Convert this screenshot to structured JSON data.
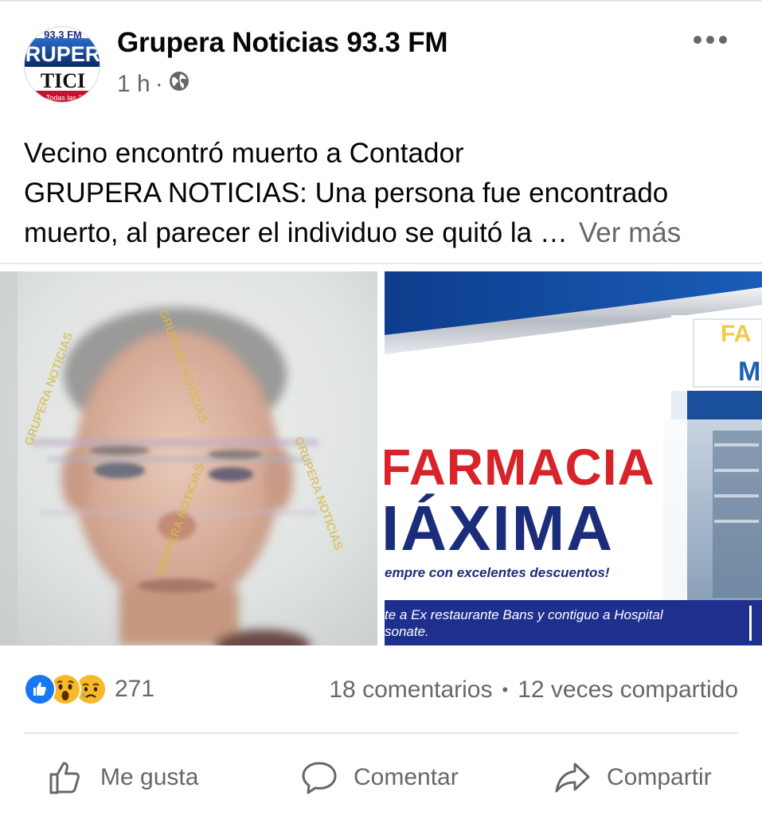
{
  "post": {
    "page_name": "Grupera Noticias 93.3 FM",
    "time": "1 h",
    "separator": "·",
    "audience_icon": "globe-icon",
    "more_icon": "more-horizontal-icon",
    "text_lines": [
      "Vecino  encontró muerto a Contador",
      "GRUPERA NOTICIAS: Una persona fue encontrado",
      "muerto, al parecer el individuo se quitó la …"
    ],
    "see_more": "Ver más"
  },
  "avatar": {
    "top": "93.3 FM",
    "middle": "RUPER",
    "bottom": "TICI",
    "tagline": "Todas las 24"
  },
  "photo_left": {
    "watermark": "GRUPERA NOTICIAS"
  },
  "photo_right": {
    "headline_1": "FARMACIA",
    "headline_2": "IÁXIMA",
    "slogan": "empre con excelentes descuentos!",
    "address_1": "te a Ex restaurante Bans y contiguo a Hospital",
    "address_2": "sonate.",
    "sign_partial_1": "FA",
    "sign_partial_2": "M"
  },
  "engagement": {
    "reactions": [
      "like-icon",
      "wow-icon",
      "sad-icon"
    ],
    "reaction_count": "271",
    "comments": "18 comentarios",
    "dot": "•",
    "shares": "12 veces compartido"
  },
  "actions": {
    "like": "Me gusta",
    "comment": "Comentar",
    "share": "Compartir"
  },
  "colors": {
    "text_primary": "#050505",
    "text_secondary": "#65676b",
    "like_blue": "#1877f2",
    "reaction_yellow": "#f7b928",
    "pharmacy_red": "#d8232a",
    "pharmacy_navy": "#1b2d7a"
  }
}
